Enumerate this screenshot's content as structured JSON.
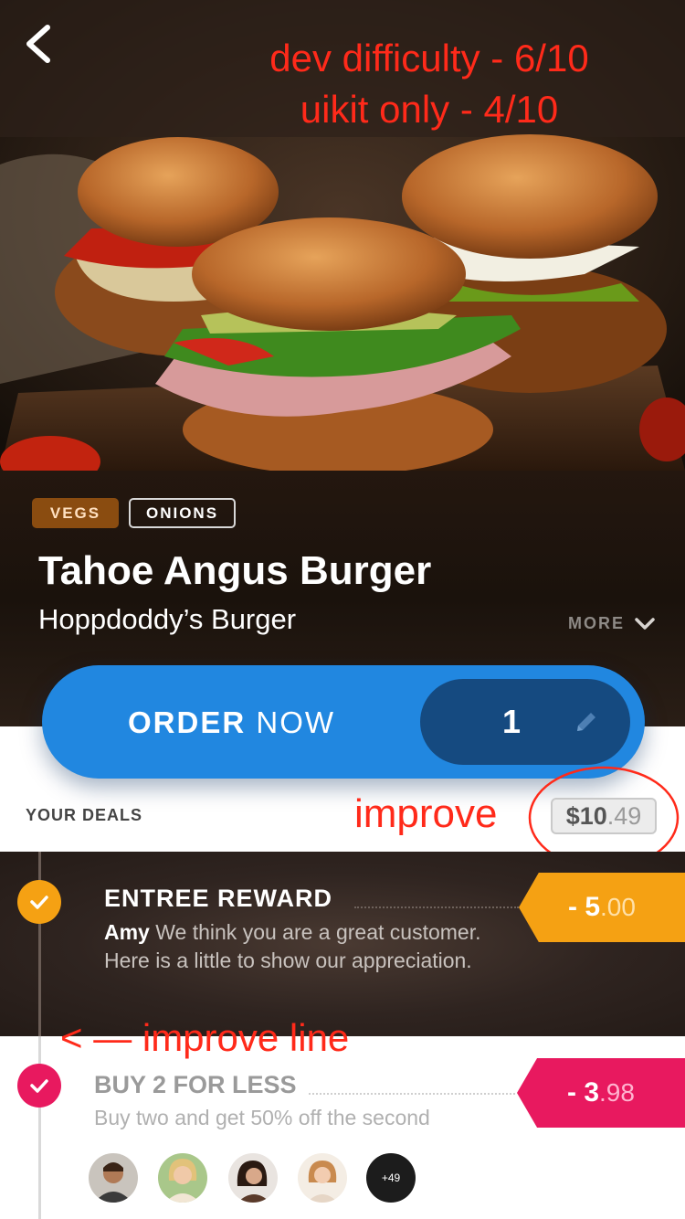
{
  "annotations": {
    "top_line1": "dev difficulty - 6/10",
    "top_line2": "uikit only - 4/10",
    "improve": "improve",
    "improve_line": "< — improve line"
  },
  "product": {
    "tags": [
      "VEGS",
      "ONIONS"
    ],
    "title": "Tahoe Angus Burger",
    "subtitle": "Hoppdoddy’s Burger",
    "more_label": "MORE"
  },
  "order": {
    "label_bold": "ORDER",
    "label_light": "NOW",
    "quantity": "1"
  },
  "deals": {
    "header": "YOUR DEALS",
    "price_dollars": "$10",
    "price_cents": ".49",
    "items": [
      {
        "title": "ENTREE REWARD",
        "name": "Amy",
        "description": " We think you are a great customer. Here is a little to show our appreciation.",
        "discount_main": "- 5",
        "discount_cents": ".00",
        "color": "#f5a113"
      },
      {
        "title": "BUY 2 FOR LESS",
        "description": "Buy two and get 50% off the second",
        "discount_main": "- 3",
        "discount_cents": ".98",
        "color": "#e8195f"
      }
    ],
    "more_users": "+49"
  },
  "colors": {
    "order_blue": "#2187e0",
    "qty_navy": "#154a80",
    "annotation_red": "#ff2a1a"
  }
}
